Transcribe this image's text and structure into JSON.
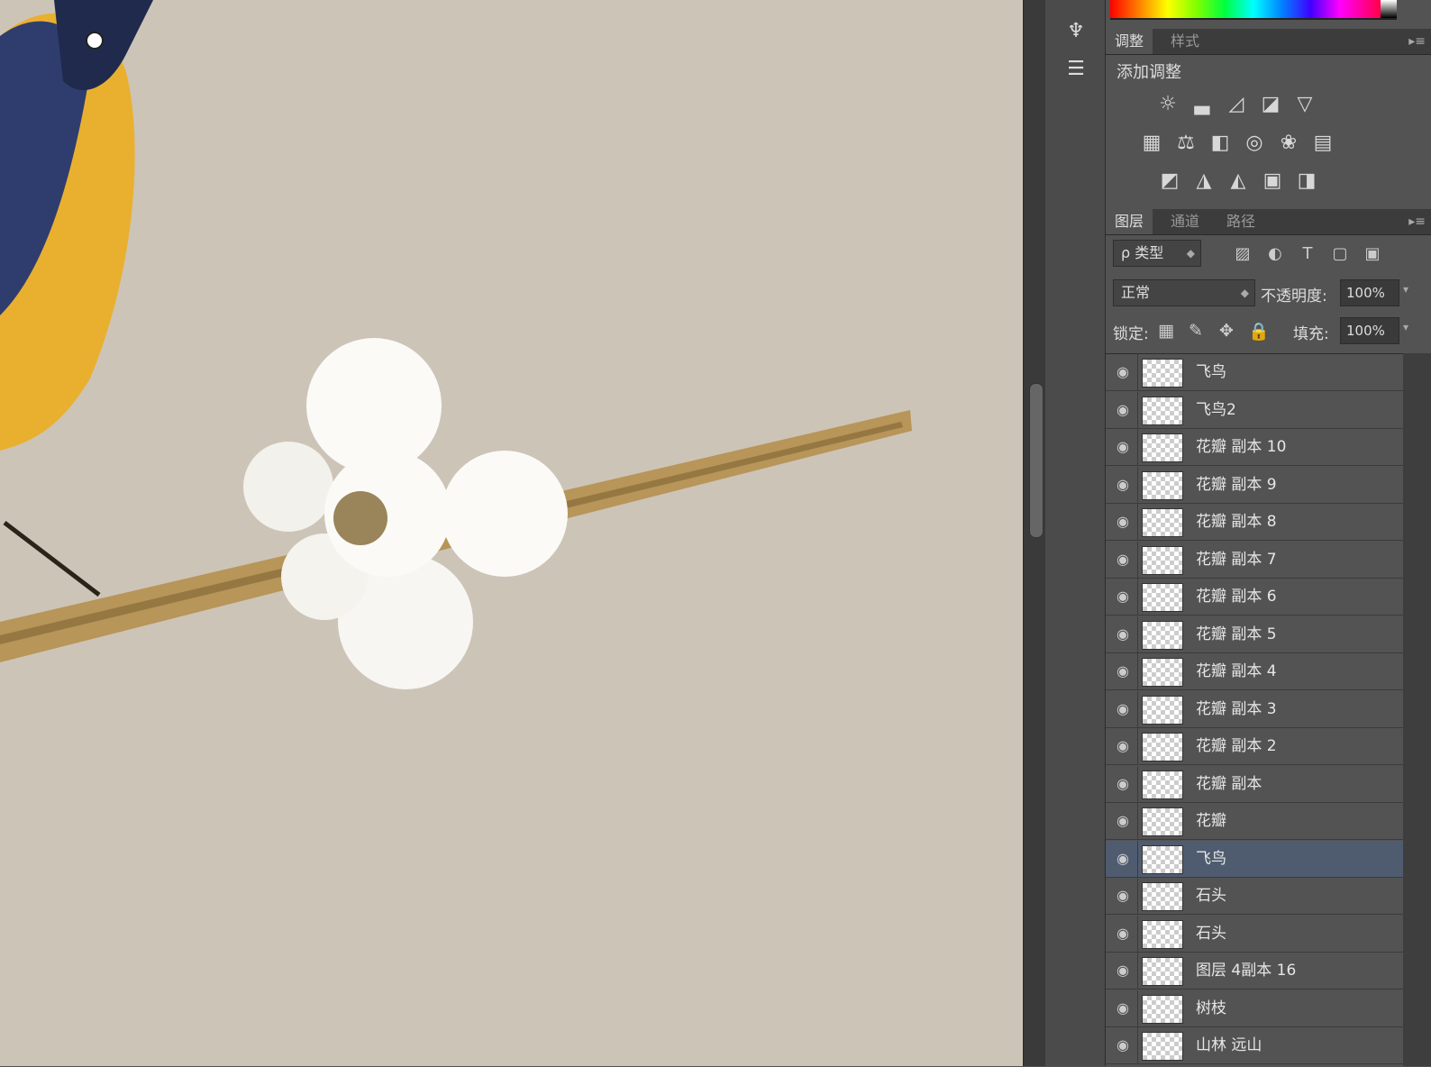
{
  "toolstrip": {
    "icons": [
      "brush-presets-icon",
      "adjust-sliders-icon"
    ]
  },
  "adjustments_panel": {
    "tabs": [
      {
        "label": "调整",
        "active": true
      },
      {
        "label": "样式",
        "active": false
      }
    ],
    "header": "添加调整",
    "icon_rows": [
      [
        "brightness-contrast-icon",
        "levels-icon",
        "curves-icon",
        "exposure-icon",
        "vibrance-icon"
      ],
      [
        "hue-saturation-icon",
        "color-balance-icon",
        "black-white-icon",
        "photo-filter-icon",
        "channel-mixer-icon",
        "color-lookup-icon"
      ],
      [
        "invert-icon",
        "posterize-icon",
        "threshold-icon",
        "gradient-map-icon",
        "selective-color-icon"
      ]
    ]
  },
  "layers_panel": {
    "tabs": [
      {
        "label": "图层",
        "active": true
      },
      {
        "label": "通道",
        "active": false
      },
      {
        "label": "路径",
        "active": false
      }
    ],
    "filter_kind": "ρ 类型",
    "blend_mode": "正常",
    "opacity_label": "不透明度:",
    "opacity_value": "100%",
    "lock_label": "锁定:",
    "fill_label": "填充:",
    "fill_value": "100%",
    "layers": [
      {
        "name": "飞鸟",
        "selected": false
      },
      {
        "name": "飞鸟2",
        "selected": false
      },
      {
        "name": "花瓣 副本 10",
        "selected": false
      },
      {
        "name": "花瓣 副本 9",
        "selected": false
      },
      {
        "name": "花瓣 副本 8",
        "selected": false
      },
      {
        "name": "花瓣 副本 7",
        "selected": false
      },
      {
        "name": "花瓣 副本 6",
        "selected": false
      },
      {
        "name": "花瓣 副本 5",
        "selected": false
      },
      {
        "name": "花瓣 副本 4",
        "selected": false
      },
      {
        "name": "花瓣 副本 3",
        "selected": false
      },
      {
        "name": "花瓣 副本 2",
        "selected": false
      },
      {
        "name": "花瓣 副本",
        "selected": false
      },
      {
        "name": "花瓣",
        "selected": false
      },
      {
        "name": "飞鸟",
        "selected": true
      },
      {
        "name": "石头",
        "selected": false
      },
      {
        "name": "石头",
        "selected": false
      },
      {
        "name": "图层 4副本 16",
        "selected": false
      },
      {
        "name": "树枝",
        "selected": false
      },
      {
        "name": "山林 远山",
        "selected": false
      }
    ]
  },
  "colors": {
    "canvas_bg": "#cdc4b8",
    "panel_bg": "#535353",
    "selected_row": "#4f5c70"
  }
}
